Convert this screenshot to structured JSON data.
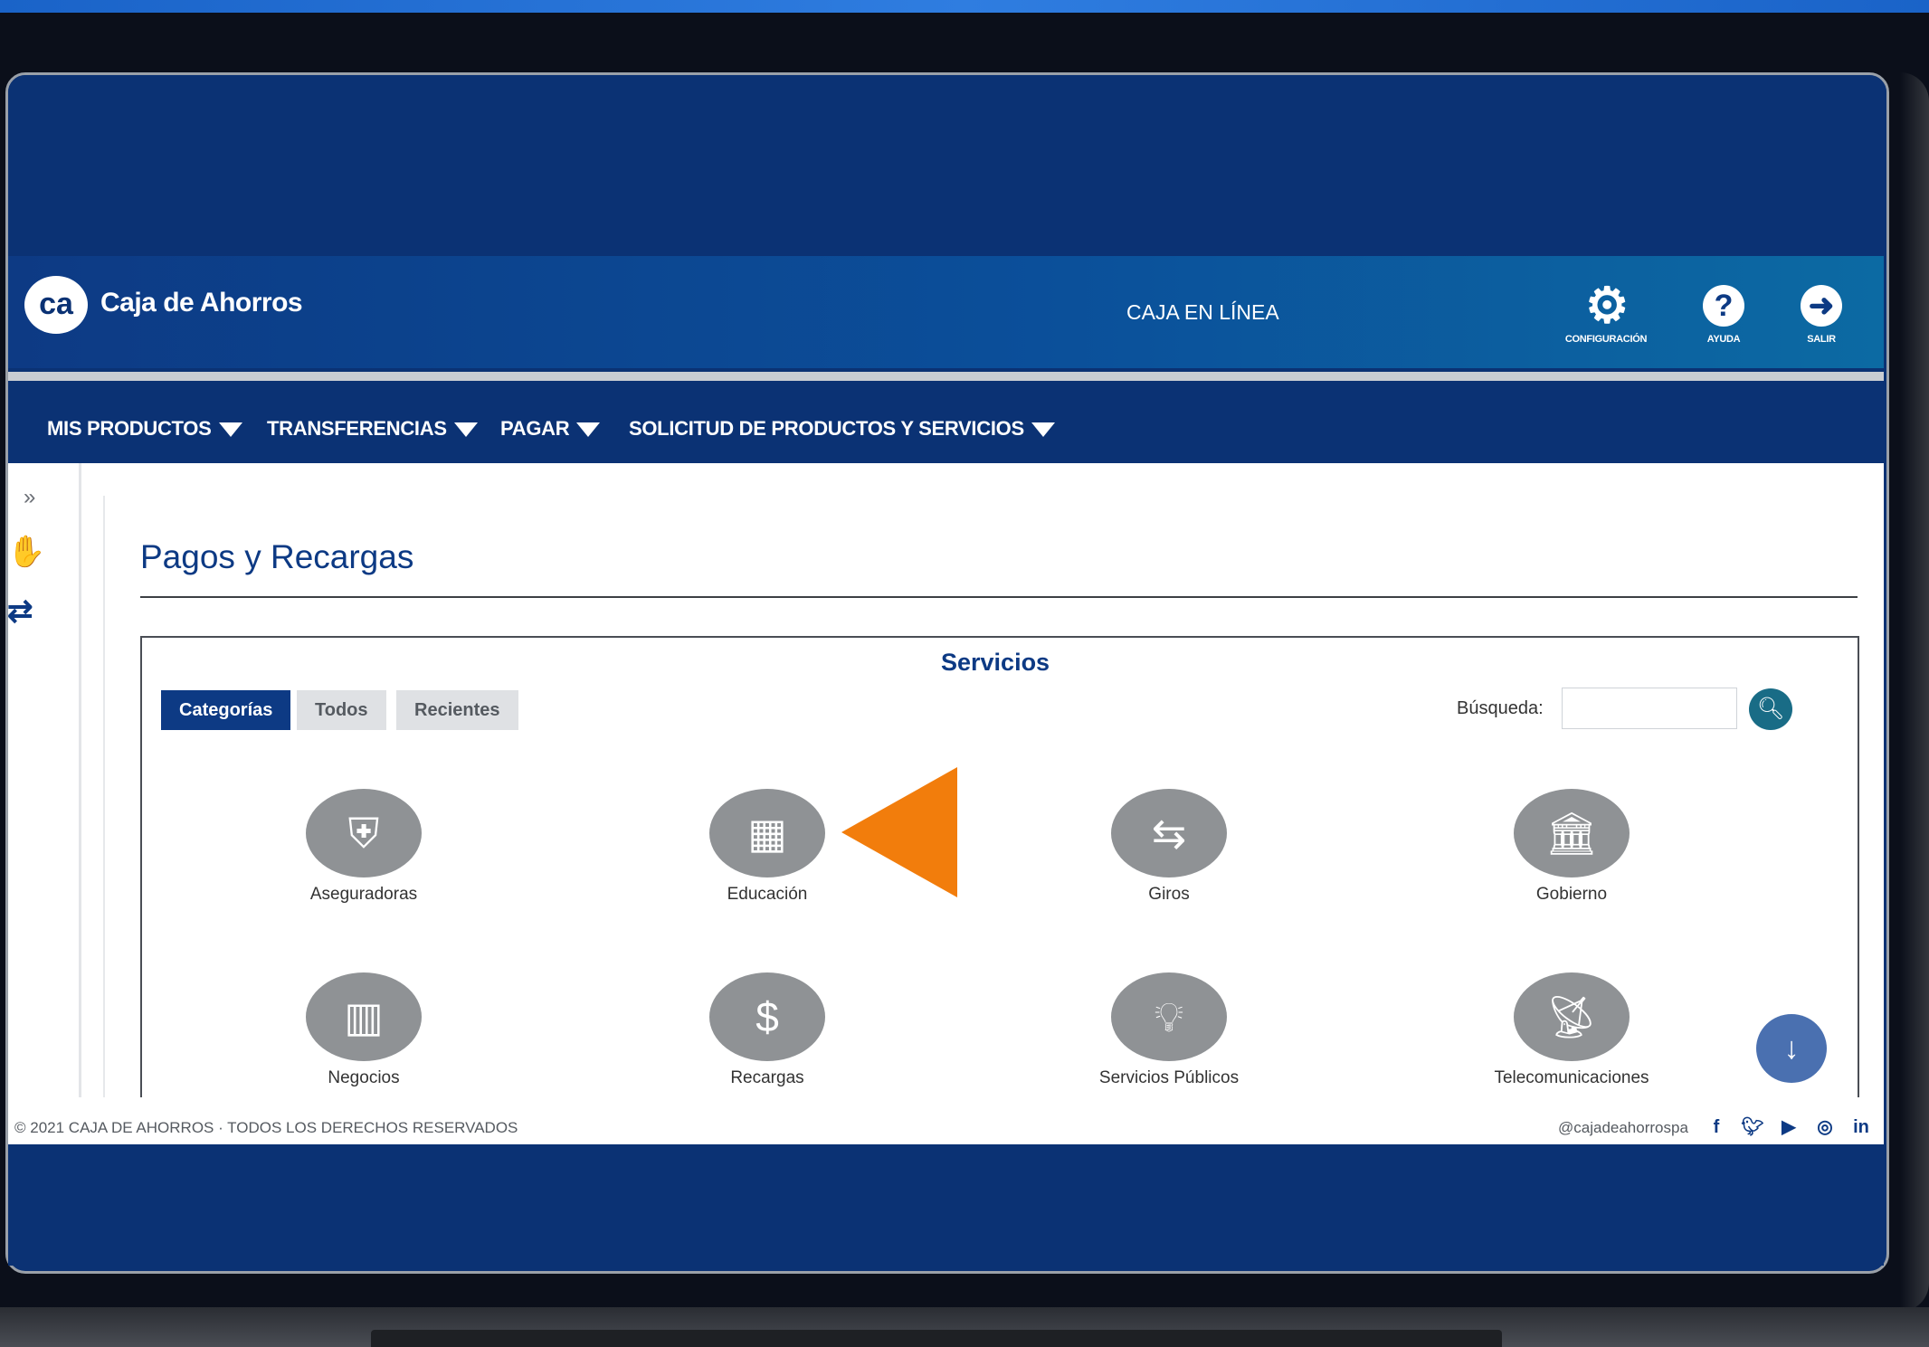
{
  "header": {
    "logo_mark": "ca",
    "brand": "Caja de Ahorros",
    "center_title": "CAJA EN LÍNEA",
    "actions": [
      {
        "label": "CONFIGURACIÓN",
        "icon": "gear-icon"
      },
      {
        "label": "AYUDA",
        "icon": "help-icon"
      },
      {
        "label": "SALIR",
        "icon": "exit-icon"
      }
    ]
  },
  "nav": {
    "items": [
      "MIS PRODUCTOS",
      "TRANSFERENCIAS",
      "PAGAR",
      "SOLICITUD DE PRODUCTOS Y SERVICIOS"
    ]
  },
  "sidebar": {
    "expand": "»",
    "icons": [
      "money-hand-icon",
      "transfer-hand-icon"
    ]
  },
  "page": {
    "title": "Pagos y Recargas",
    "panel_title": "Servicios",
    "tabs": [
      {
        "label": "Categorías",
        "active": true
      },
      {
        "label": "Todos",
        "active": false
      },
      {
        "label": "Recientes",
        "active": false
      }
    ],
    "search_label": "Búsqueda:",
    "search_value": "",
    "categories": [
      {
        "label": "Aseguradoras",
        "icon": "insurance-icon"
      },
      {
        "label": "Educación",
        "icon": "education-icon"
      },
      {
        "label": "Giros",
        "icon": "money-transfer-icon"
      },
      {
        "label": "Gobierno",
        "icon": "government-icon"
      },
      {
        "label": "Negocios",
        "icon": "building-icon"
      },
      {
        "label": "Recargas",
        "icon": "recharge-icon"
      },
      {
        "label": "Servicios Públicos",
        "icon": "utilities-icon"
      },
      {
        "label": "Telecomunicaciones",
        "icon": "antenna-icon"
      }
    ]
  },
  "footer": {
    "copyright": "© 2021 CAJA DE AHORROS · TODOS LOS DERECHOS RESERVADOS",
    "handle": "@cajadeahorrospa",
    "social": [
      "facebook-icon",
      "twitter-icon",
      "youtube-icon",
      "instagram-icon",
      "linkedin-icon"
    ]
  },
  "colors": {
    "navy": "#0b3274",
    "accent_orange": "#f27d0c",
    "search_teal": "#196c86",
    "icon_gray": "#8f9295"
  }
}
